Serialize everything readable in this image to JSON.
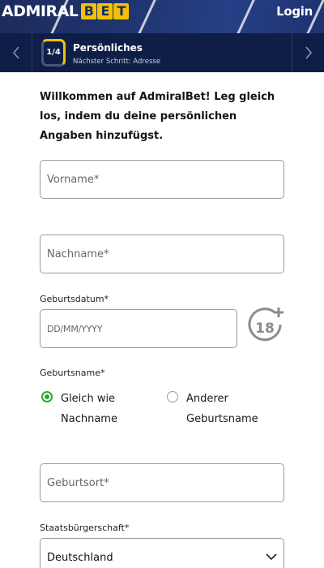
{
  "header": {
    "logo_text_1": "ADMIRAL",
    "logo_text_2": [
      "B",
      "E",
      "T"
    ],
    "login_label": "Login"
  },
  "stepper": {
    "step": "1/4",
    "title": "Persönliches",
    "subtitle": "Nächster Schritt: Adresse",
    "prev_icon": "chevron-left-icon",
    "next_icon": "chevron-right-icon"
  },
  "intro_text": "Willkommen auf AdmiralBet! Leg gleich los, indem du deine persönlichen Angaben hinzufügst.",
  "form": {
    "firstname": {
      "placeholder": "Vorname*",
      "value": ""
    },
    "lastname": {
      "placeholder": "Nachname*",
      "value": ""
    },
    "birthdate": {
      "label": "Geburtsdatum*",
      "placeholder": "DD/MM/YYYY",
      "value": "",
      "age_badge": "18+"
    },
    "birthname": {
      "label": "Geburtsname*",
      "options": [
        {
          "label": "Gleich wie Nachname",
          "selected": true
        },
        {
          "label": "Anderer Geburtsname",
          "selected": false
        }
      ]
    },
    "birthplace": {
      "placeholder": "Geburtsort*",
      "value": ""
    },
    "citizenship": {
      "label": "Staatsbürgerschaft*",
      "value": "Deutschland"
    }
  },
  "colors": {
    "header_bg": "#213673",
    "stepbar_bg": "#0f1e47",
    "accent_yellow": "#f4c200",
    "radio_green": "#2fa534"
  }
}
